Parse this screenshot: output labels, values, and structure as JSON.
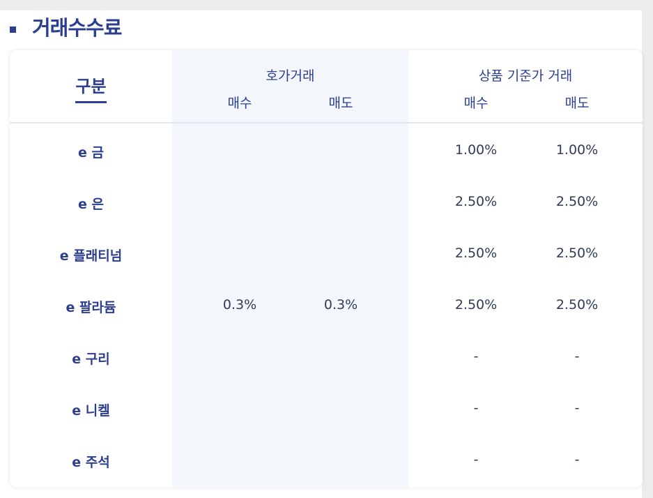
{
  "section": {
    "title": "거래수수료"
  },
  "table": {
    "header": {
      "category": "구분",
      "group1": "호가거래",
      "group2": "상품 기준가 거래",
      "buy": "매수",
      "sell": "매도"
    },
    "rows": [
      {
        "label": "e 금",
        "std_buy": "1.00%",
        "std_sell": "1.00%"
      },
      {
        "label": "e 은",
        "std_buy": "2.50%",
        "std_sell": "2.50%"
      },
      {
        "label": "e 플래티넘",
        "std_buy": "2.50%",
        "std_sell": "2.50%"
      },
      {
        "label": "e 팔라듐",
        "std_buy": "2.50%",
        "std_sell": "2.50%"
      },
      {
        "label": "e 구리",
        "std_buy": "-",
        "std_sell": "-"
      },
      {
        "label": "e 니켈",
        "std_buy": "-",
        "std_sell": "-"
      },
      {
        "label": "e 주석",
        "std_buy": "-",
        "std_sell": "-"
      }
    ],
    "quote_buy": "0.3%",
    "quote_sell": "0.3%"
  },
  "colors": {
    "accent": "#2b3e8f",
    "band": "#f3f7fc",
    "value_text": "#2f3b57"
  }
}
